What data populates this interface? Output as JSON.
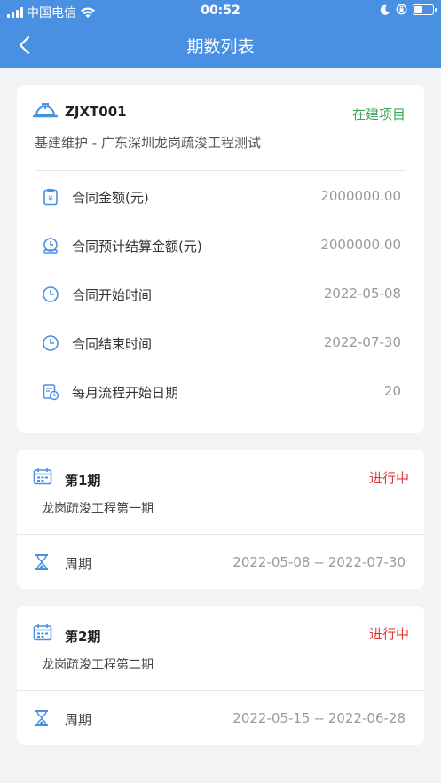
{
  "status_bar": {
    "carrier": "中国电信",
    "time": "00:52"
  },
  "nav": {
    "title": "期数列表"
  },
  "project": {
    "code": "ZJXT001",
    "status": "在建项目",
    "status_color": "#3ea35b",
    "subtitle": "基建维护 - 广东深圳龙岗疏浚工程测试",
    "rows": [
      {
        "icon": "contract-amount-icon",
        "label": "合同金额(元)",
        "value": "2000000.00"
      },
      {
        "icon": "settlement-amount-icon",
        "label": "合同预计结算金额(元)",
        "value": "2000000.00"
      },
      {
        "icon": "clock-icon",
        "label": "合同开始时间",
        "value": "2022-05-08"
      },
      {
        "icon": "clock-icon",
        "label": "合同结束时间",
        "value": "2022-07-30"
      },
      {
        "icon": "calendar-clock-icon",
        "label": "每月流程开始日期",
        "value": "20"
      }
    ]
  },
  "periods": [
    {
      "title": "第1期",
      "status": "进行中",
      "subtitle": "龙岗疏浚工程第一期",
      "cycle_label": "周期",
      "cycle_value": "2022-05-08 -- 2022-07-30"
    },
    {
      "title": "第2期",
      "status": "进行中",
      "subtitle": "龙岗疏浚工程第二期",
      "cycle_label": "周期",
      "cycle_value": "2022-05-15 -- 2022-06-28"
    }
  ],
  "colors": {
    "header": "#4a90e2",
    "accent_icon": "#4a90e2",
    "in_progress": "#e03a3a"
  }
}
